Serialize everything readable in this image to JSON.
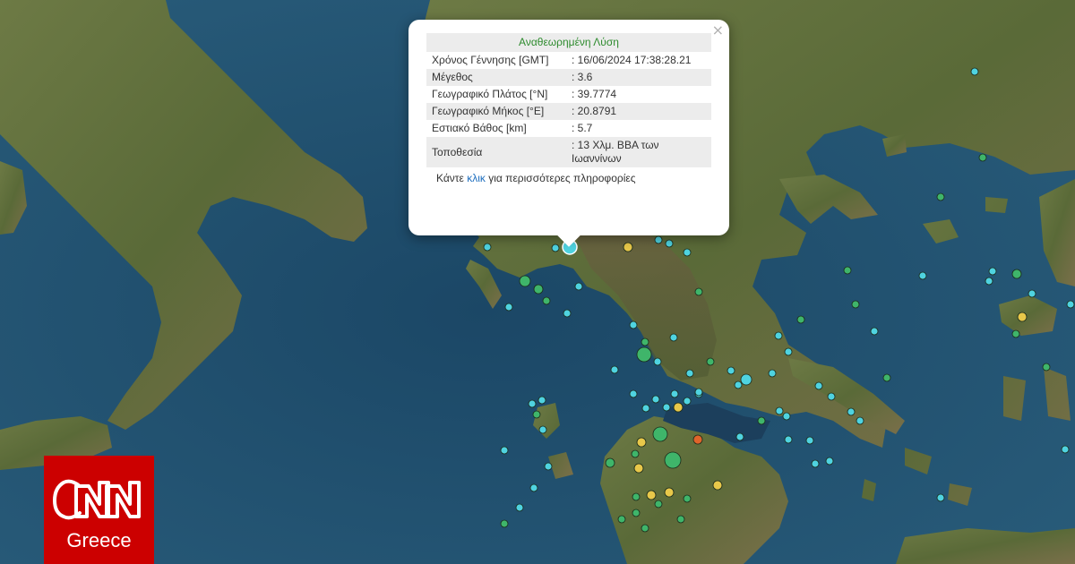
{
  "popup": {
    "title": "Αναθεωρημένη Λύση",
    "close": "×",
    "rows": [
      {
        "label": "Χρόνος Γέννησης [GMT]",
        "value": ": 16/06/2024 17:38:28.21"
      },
      {
        "label": "Μέγεθος",
        "value": ": 3.6"
      },
      {
        "label": "Γεωγραφικό Πλάτος [°N]",
        "value": ": 39.7774"
      },
      {
        "label": "Γεωγραφικό Μήκος [°E]",
        "value": ": 20.8791"
      },
      {
        "label": "Εστιακό Βάθος [km]",
        "value": ": 5.7"
      },
      {
        "label": "Τοποθεσία",
        "value": ": 13 Χλμ. ΒΒΑ των Ιωαννίνων"
      }
    ],
    "more_prefix": "Κάντε ",
    "more_link": "κλικ",
    "more_suffix": " για περισσότερες πληροφορίες"
  },
  "logo": {
    "brand": "CNN",
    "region": "Greece"
  },
  "colors": {
    "sea": "#1f4f6e",
    "land": "#5f6f3c",
    "marker_cyan": "#4fd3e0",
    "marker_green": "#3fb56a",
    "marker_yellow": "#e8c84a",
    "marker_orange": "#e0642a",
    "popup_title": "#2e8b2e",
    "link": "#1f6fbf",
    "logo_red": "#cc0000"
  }
}
